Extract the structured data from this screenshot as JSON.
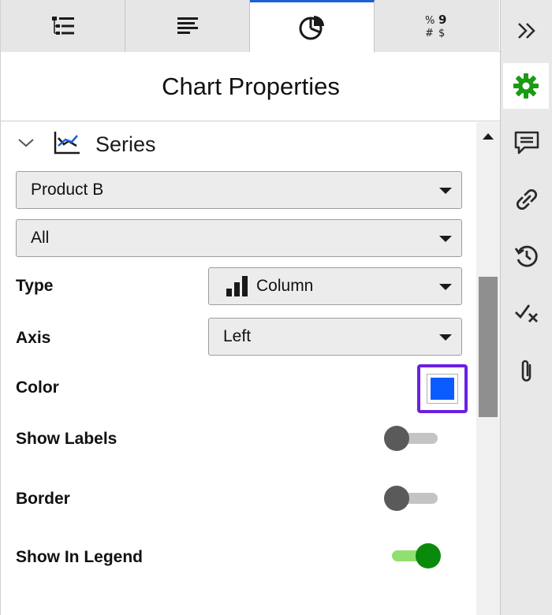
{
  "colors": {
    "accent_tab": "#1f5fd6",
    "selected_outline": "#6b1fe4",
    "series_color": "#0a5cff",
    "toggle_on": "#0a8a0a",
    "toggle_on_track": "#90e070",
    "toggle_off": "#5a5a5a",
    "toggle_off_track": "#c4c4c4",
    "gear_active": "#1b9a12"
  },
  "tabs": [
    {
      "icon": "field-list-icon",
      "active": false
    },
    {
      "icon": "text-format-icon",
      "active": false
    },
    {
      "icon": "pie-chart-icon",
      "active": true
    },
    {
      "icon": "number-format-icon",
      "active": false
    }
  ],
  "panel_title": "Chart Properties",
  "series_section": {
    "label": "Series",
    "expanded": true
  },
  "series_select": {
    "value": "Product B"
  },
  "range_select": {
    "value": "All"
  },
  "type": {
    "label": "Type",
    "value": "Column"
  },
  "axis": {
    "label": "Axis",
    "value": "Left"
  },
  "color": {
    "label": "Color",
    "value": "#0a5cff"
  },
  "show_labels": {
    "label": "Show Labels",
    "on": false
  },
  "border": {
    "label": "Border",
    "on": false
  },
  "show_in_legend": {
    "label": "Show In Legend",
    "on": true
  },
  "rail": [
    {
      "icon": "expand-chevrons-icon"
    },
    {
      "icon": "gear-icon",
      "active": true
    },
    {
      "icon": "comment-icon"
    },
    {
      "icon": "link-icon"
    },
    {
      "icon": "history-icon"
    },
    {
      "icon": "check-x-icon"
    },
    {
      "icon": "paperclip-icon"
    }
  ]
}
